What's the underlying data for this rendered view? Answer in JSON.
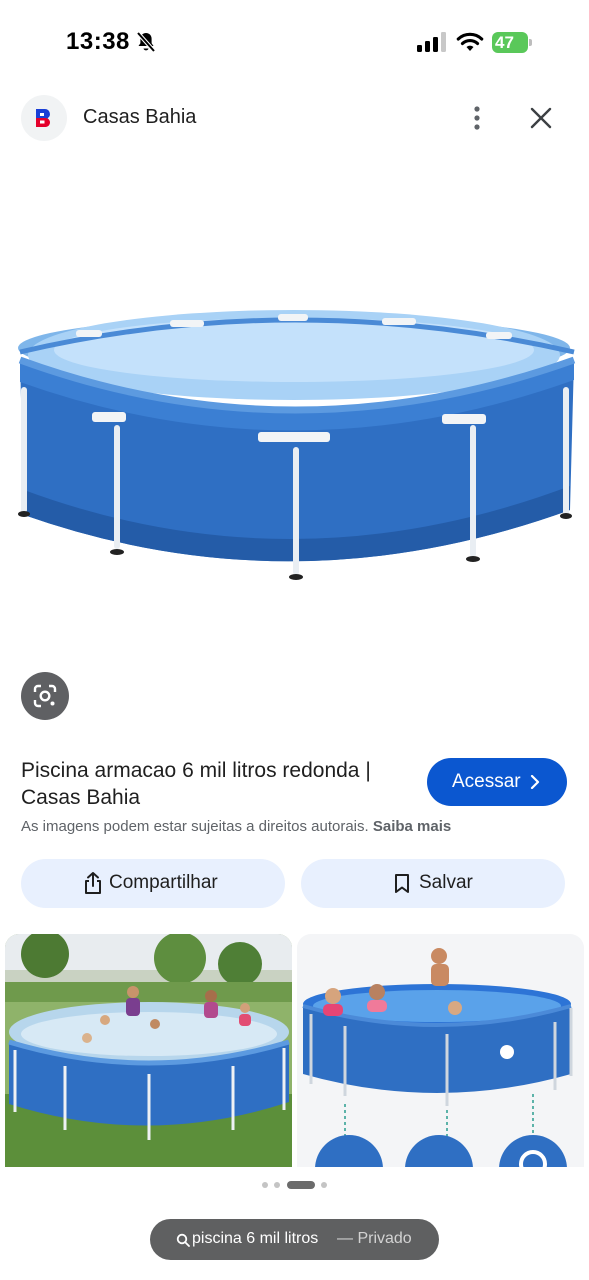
{
  "status_bar": {
    "time": "13:38",
    "battery": "47"
  },
  "header": {
    "site_name": "Casas Bahia",
    "logo_letter": "B"
  },
  "result": {
    "title": "Piscina armacao 6 mil litros redonda | Casas Bahia",
    "visit_label": "Acessar",
    "copyright_text": "As imagens podem estar sujeitas a direitos autorais.",
    "learn_more": "Saiba mais"
  },
  "actions": {
    "share_label": "Compartilhar",
    "save_label": "Salvar"
  },
  "search_bar": {
    "query": "piscina 6 mil litros",
    "mode": "— Privado"
  },
  "colors": {
    "accent": "#0b57d0",
    "pool_blue": "#2f6fc3",
    "chip_bg": "#e8f0fe"
  },
  "icons": [
    "bell-slash-icon",
    "signal-icon",
    "wifi-icon",
    "battery-icon",
    "more-vert-icon",
    "close-icon",
    "lens-icon",
    "chevron-right-icon",
    "share-icon",
    "bookmark-icon",
    "search-icon"
  ]
}
